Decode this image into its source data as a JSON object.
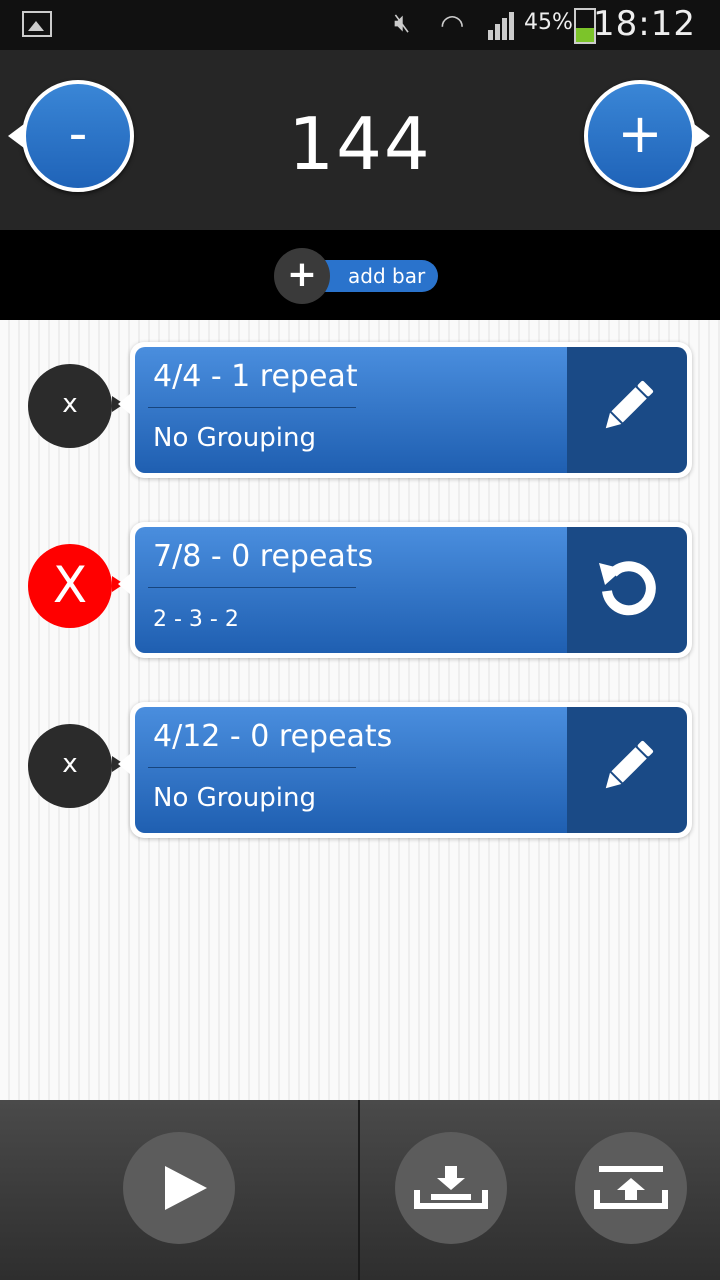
{
  "status_bar": {
    "battery": "45%",
    "time": "18:12"
  },
  "tempo": {
    "bpm": "144",
    "decrement_label": "-",
    "increment_label": "+"
  },
  "add_bar": {
    "label": "add bar"
  },
  "bars": [
    {
      "title": "4/4  -  1 repeat",
      "subtitle": "No Grouping",
      "delete_label": "x",
      "action_icon": "pencil-icon"
    },
    {
      "title": "7/8  -  0 repeats",
      "subtitle": "2 - 3 - 2",
      "delete_label": "X",
      "action_icon": "undo-icon"
    },
    {
      "title": "4/12  -  0 repeats",
      "subtitle": "No Grouping",
      "delete_label": "x",
      "action_icon": "pencil-icon"
    }
  ],
  "colors": {
    "accent": "#2a73cc",
    "card_dark": "#1a4a86",
    "delete_active": "#ff0000"
  }
}
